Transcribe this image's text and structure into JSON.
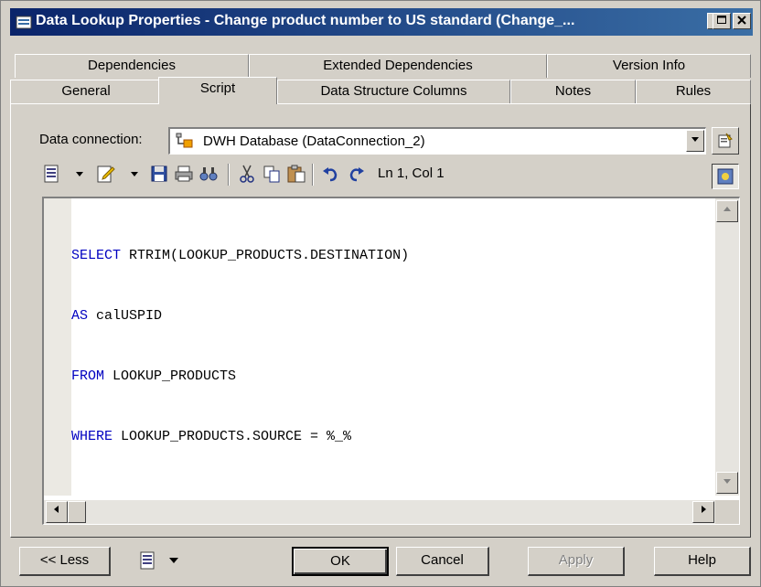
{
  "window": {
    "title": "Data Lookup Properties - Change product number to US standard (Change_...",
    "controls": [
      "minimize",
      "maximize",
      "close"
    ]
  },
  "tabs": {
    "row_back": [
      {
        "label": "Dependencies"
      },
      {
        "label": "Extended Dependencies"
      },
      {
        "label": "Version Info"
      }
    ],
    "row_front": [
      {
        "label": "General"
      },
      {
        "label": "Script",
        "active": true
      },
      {
        "label": "Data Structure Columns"
      },
      {
        "label": "Notes"
      },
      {
        "label": "Rules"
      }
    ]
  },
  "connection": {
    "label": "Data connection:",
    "value": "DWH Database (DataConnection_2)"
  },
  "toolbar": {
    "position_text": "Ln 1, Col 1",
    "icons": [
      "sql-menu-icon",
      "edit-icon",
      "save-icon",
      "print-icon",
      "find-icon",
      "cut-icon",
      "copy-icon",
      "paste-icon",
      "undo-icon",
      "redo-icon",
      "properties-icon"
    ]
  },
  "editor": {
    "lines": [
      {
        "kw": "SELECT",
        "rest": " RTRIM(LOOKUP_PRODUCTS.DESTINATION)"
      },
      {
        "kw": "AS",
        "rest": " calUSPID"
      },
      {
        "kw": "FROM",
        "rest": " LOOKUP_PRODUCTS"
      },
      {
        "kw": "WHERE",
        "rest": " LOOKUP_PRODUCTS.SOURCE = %_%"
      }
    ],
    "keyword_color": "#0000c0"
  },
  "buttons": {
    "less": "<< Less",
    "ok": "OK",
    "cancel": "Cancel",
    "apply": "Apply",
    "help": "Help"
  },
  "colors": {
    "titlebar_start": "#0a246a",
    "titlebar_end": "#3a6ea5",
    "face": "#d4d0c8"
  }
}
